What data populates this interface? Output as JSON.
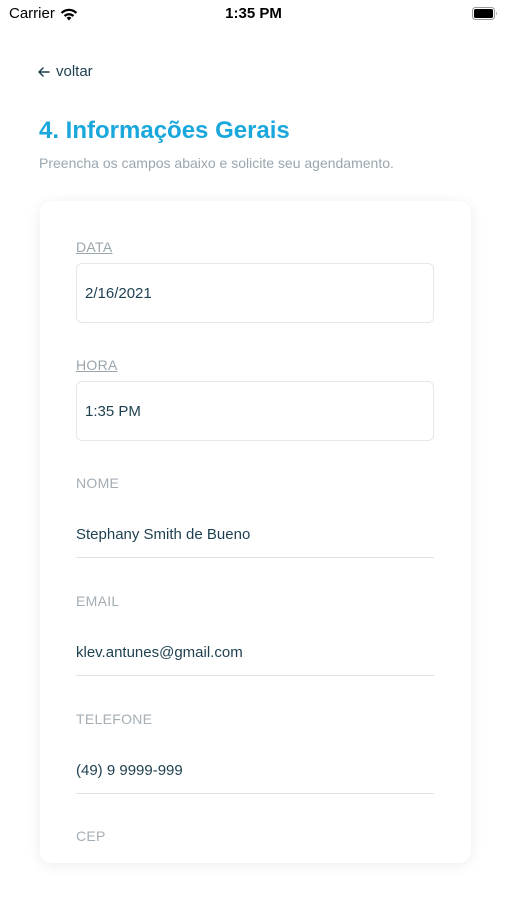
{
  "status_bar": {
    "carrier": "Carrier",
    "time": "1:35 PM"
  },
  "nav": {
    "back_label": "voltar"
  },
  "header": {
    "title": "4. Informações Gerais",
    "subtitle": "Preencha os campos abaixo e solicite seu agendamento."
  },
  "form": {
    "date": {
      "label": "DATA",
      "value": "2/16/2021"
    },
    "time": {
      "label": "HORA",
      "value": "1:35 PM"
    },
    "name": {
      "label": "NOME",
      "value": "Stephany Smith de Bueno"
    },
    "email": {
      "label": "EMAIL",
      "value": "klev.antunes@gmail.com"
    },
    "phone": {
      "label": "TELEFONE",
      "value": "(49) 9 9999-999"
    },
    "cep": {
      "label": "CEP"
    }
  },
  "colors": {
    "accent": "#1aa7dc",
    "text": "#1d3f4f",
    "muted": "#9aa6ae"
  }
}
